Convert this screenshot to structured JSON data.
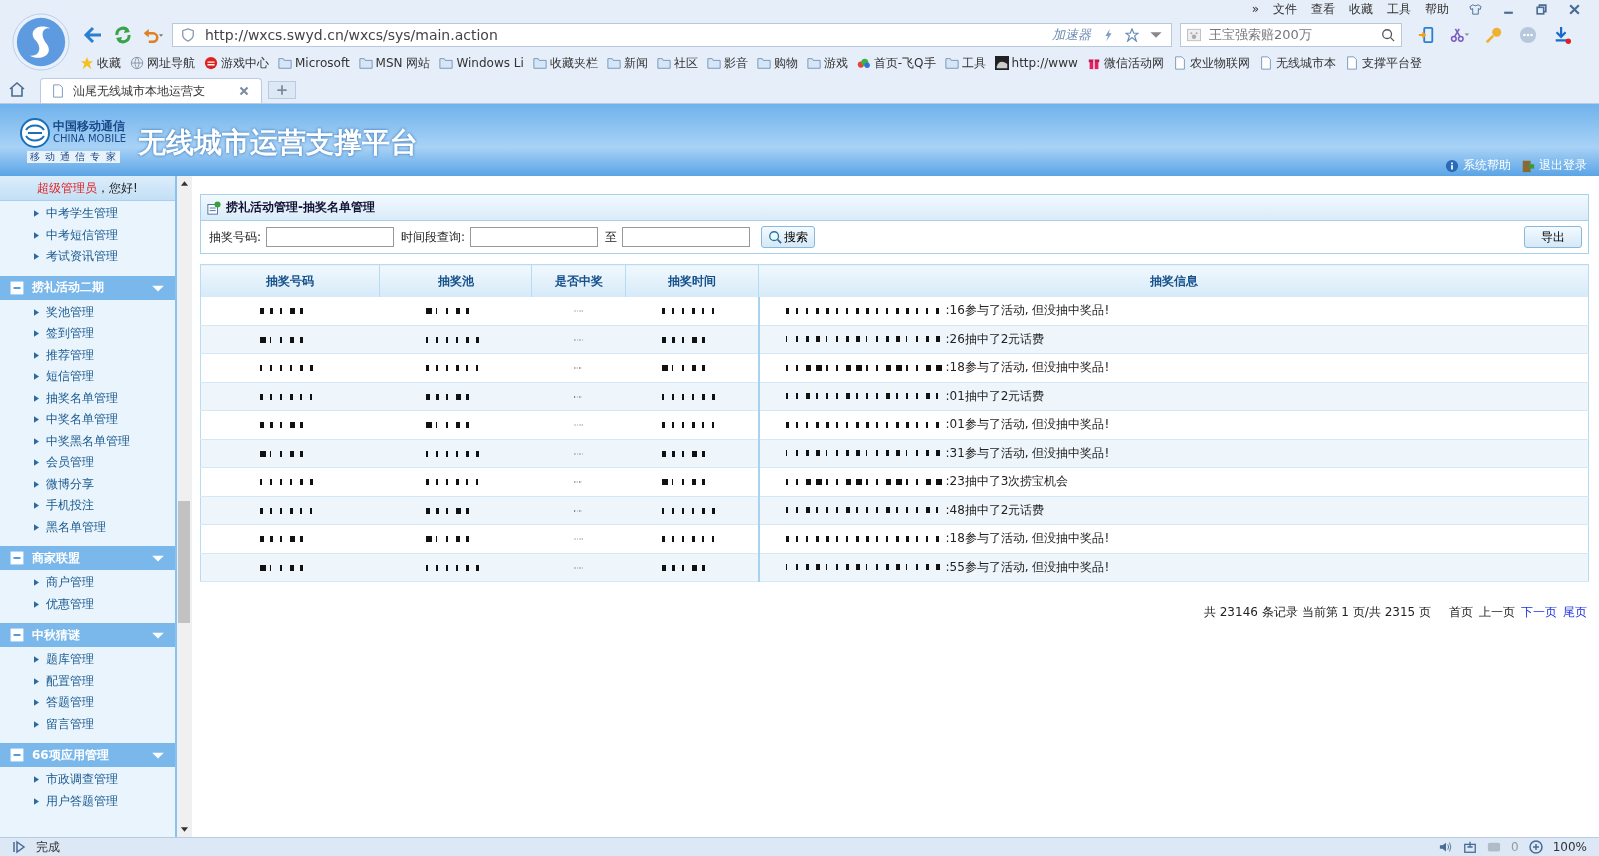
{
  "browser": {
    "menu": [
      "»",
      "文件",
      "查看",
      "收藏",
      "工具",
      "帮助"
    ],
    "address": {
      "value": "http://wxcs.swyd.cn/wxcs/sys/main.action",
      "accelerator": "加速器"
    },
    "search": {
      "placeholder": "王宝强索赔200万"
    },
    "bookmarks": [
      {
        "label": "收藏",
        "kind": "star"
      },
      {
        "label": "网址导航",
        "kind": "globe"
      },
      {
        "label": "游戏中心",
        "kind": "game"
      },
      {
        "label": "Microsoft",
        "kind": "folder"
      },
      {
        "label": "MSN 网站",
        "kind": "folder"
      },
      {
        "label": "Windows Li",
        "kind": "folder"
      },
      {
        "label": "收藏夹栏",
        "kind": "folder"
      },
      {
        "label": "新闻",
        "kind": "folder"
      },
      {
        "label": "社区",
        "kind": "folder"
      },
      {
        "label": "影音",
        "kind": "folder"
      },
      {
        "label": "购物",
        "kind": "folder"
      },
      {
        "label": "游戏",
        "kind": "folder"
      },
      {
        "label": "首页-飞Q手",
        "kind": "cloud"
      },
      {
        "label": "工具",
        "kind": "folder"
      },
      {
        "label": "http://www",
        "kind": "image"
      },
      {
        "label": "微信活动网",
        "kind": "gift"
      },
      {
        "label": "农业物联网",
        "kind": "page"
      },
      {
        "label": "无线城市本",
        "kind": "page"
      },
      {
        "label": "支撑平台登",
        "kind": "page"
      }
    ],
    "tabs": [
      {
        "label": "汕尾无线城市本地运营支",
        "selected": true
      }
    ]
  },
  "header": {
    "logo_cn": "中国移动通信",
    "logo_en": "CHINA MOBILE",
    "logo_slogan": "移 动 通 信 专 家",
    "title": "无线城市运营支撑平台",
    "links": [
      "系统帮助",
      "退出登录"
    ]
  },
  "sidebar": {
    "greeting_role": "超级管理员",
    "greeting": "，您好!",
    "sections": [
      {
        "items": [
          "中考学生管理",
          "中考短信管理",
          "考试资讯管理"
        ]
      },
      {
        "title": "捞礼活动二期",
        "items": [
          "奖池管理",
          "签到管理",
          "推荐管理",
          "短信管理",
          "抽奖名单管理",
          "中奖名单管理",
          "中奖黑名单管理",
          "会员管理",
          "微博分享",
          "手机投注",
          "黑名单管理"
        ]
      },
      {
        "title": "商家联盟",
        "items": [
          "商户管理",
          "优惠管理"
        ]
      },
      {
        "title": "中秋猜谜",
        "items": [
          "题库管理",
          "配置管理",
          "答题管理",
          "留言管理"
        ]
      },
      {
        "title": "66项应用管理",
        "items": [
          "市政调查管理",
          "用户答题管理"
        ]
      }
    ]
  },
  "panel": {
    "title": "捞礼活动管理-抽奖名单管理",
    "filters": [
      {
        "label": "抽奖号码:"
      },
      {
        "label": "时间段查询:"
      },
      {
        "label": "至"
      }
    ],
    "search_button": "搜索",
    "export_button": "导出",
    "columns": [
      "抽奖号码",
      "抽奖池",
      "是否中奖",
      "抽奖时间",
      "抽奖信息"
    ],
    "rows": [
      {
        "masked": true,
        "info": ":16参与了活动, 但没抽中奖品!"
      },
      {
        "masked": true,
        "info": ":26抽中了2元话费"
      },
      {
        "masked": true,
        "info": ":18参与了活动, 但没抽中奖品!"
      },
      {
        "masked": true,
        "info": ":01抽中了2元话费"
      },
      {
        "masked": true,
        "info": ":01参与了活动, 但没抽中奖品!"
      },
      {
        "masked": true,
        "info": ":31参与了活动, 但没抽中奖品!"
      },
      {
        "masked": true,
        "info": ":23抽中了3次捞宝机会"
      },
      {
        "masked": true,
        "info": ":48抽中了2元话费"
      },
      {
        "masked": true,
        "info": ":18参与了活动, 但没抽中奖品!"
      },
      {
        "masked": true,
        "info": ":55参与了活动, 但没抽中奖品!"
      }
    ],
    "pagination": {
      "summary": "共 23146 条记录 当前第 1 页/共 2315 页",
      "links": [
        {
          "label": "首页",
          "enabled": false
        },
        {
          "label": "上一页",
          "enabled": false
        },
        {
          "label": "下一页",
          "enabled": true
        },
        {
          "label": "尾页",
          "enabled": true
        }
      ]
    }
  },
  "status_bar": {
    "text": "完成",
    "count": "0",
    "zoom": "100%"
  }
}
